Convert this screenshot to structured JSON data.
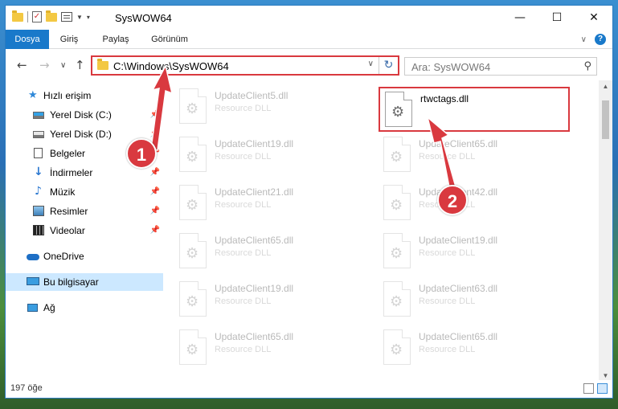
{
  "window": {
    "title": "SysWOW64",
    "controls": {
      "minimize": "—",
      "maximize": "☐",
      "close": "✕"
    }
  },
  "ribbon": {
    "tabs": [
      "Dosya",
      "Giriş",
      "Paylaş",
      "Görünüm"
    ],
    "help": "?"
  },
  "navbar": {
    "address": "C:\\Windows\\SysWOW64",
    "search_placeholder": "Ara: SysWOW64"
  },
  "sidebar": {
    "items": [
      {
        "label": "Hızlı erişim",
        "icon": "star-icon",
        "pinned": false
      },
      {
        "label": "Yerel Disk (C:)",
        "icon": "drive-icon",
        "pinned": true
      },
      {
        "label": "Yerel Disk (D:)",
        "icon": "drive-icon",
        "pinned": true
      },
      {
        "label": "Belgeler",
        "icon": "document-icon",
        "pinned": true
      },
      {
        "label": "İndirmeler",
        "icon": "download-icon",
        "pinned": true
      },
      {
        "label": "Müzik",
        "icon": "music-icon",
        "pinned": true
      },
      {
        "label": "Resimler",
        "icon": "pictures-icon",
        "pinned": true
      },
      {
        "label": "Videolar",
        "icon": "videos-icon",
        "pinned": true
      },
      {
        "label": "OneDrive",
        "icon": "cloud-icon",
        "pinned": false
      },
      {
        "label": "Bu bilgisayar",
        "icon": "computer-icon",
        "pinned": false
      },
      {
        "label": "Ağ",
        "icon": "network-icon",
        "pinned": false
      }
    ],
    "selected": "Bu bilgisayar"
  },
  "files": {
    "left": [
      {
        "name": "UpdateClient5.dll",
        "desc": "Resource DLL"
      },
      {
        "name": "UpdateClient19.dll",
        "desc": "Resource DLL"
      },
      {
        "name": "UpdateClient21.dll",
        "desc": "Resource DLL"
      },
      {
        "name": "UpdateClient65.dll",
        "desc": "Resource DLL"
      },
      {
        "name": "UpdateClient19.dll",
        "desc": "Resource DLL"
      },
      {
        "name": "UpdateClient65.dll",
        "desc": "Resource DLL"
      }
    ],
    "right": [
      {
        "name": "rtwctags.dll",
        "desc": ""
      },
      {
        "name": "UpdateClient65.dll",
        "desc": "Resource DLL"
      },
      {
        "name": "UpdateClient42.dll",
        "desc": "Resource DLL"
      },
      {
        "name": "UpdateClient19.dll",
        "desc": "Resource DLL"
      },
      {
        "name": "UpdateClient63.dll",
        "desc": "Resource DLL"
      },
      {
        "name": "UpdateClient65.dll",
        "desc": "Resource DLL"
      }
    ]
  },
  "status": {
    "item_count": "197 öğe"
  },
  "annotations": {
    "step1": "1",
    "step2": "2",
    "color": "#d9393f"
  }
}
